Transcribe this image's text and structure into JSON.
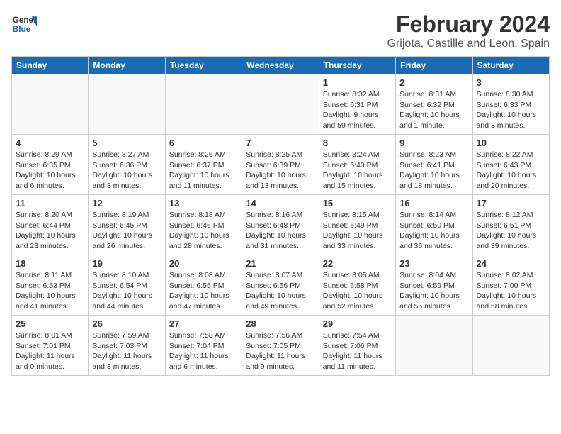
{
  "header": {
    "logo_line1": "General",
    "logo_line2": "Blue",
    "month_year": "February 2024",
    "location": "Grijota, Castille and Leon, Spain"
  },
  "weekdays": [
    "Sunday",
    "Monday",
    "Tuesday",
    "Wednesday",
    "Thursday",
    "Friday",
    "Saturday"
  ],
  "weeks": [
    [
      {
        "day": "",
        "info": ""
      },
      {
        "day": "",
        "info": ""
      },
      {
        "day": "",
        "info": ""
      },
      {
        "day": "",
        "info": ""
      },
      {
        "day": "1",
        "info": "Sunrise: 8:32 AM\nSunset: 6:31 PM\nDaylight: 9 hours and 59 minutes."
      },
      {
        "day": "2",
        "info": "Sunrise: 8:31 AM\nSunset: 6:32 PM\nDaylight: 10 hours and 1 minute."
      },
      {
        "day": "3",
        "info": "Sunrise: 8:30 AM\nSunset: 6:33 PM\nDaylight: 10 hours and 3 minutes."
      }
    ],
    [
      {
        "day": "4",
        "info": "Sunrise: 8:29 AM\nSunset: 6:35 PM\nDaylight: 10 hours and 6 minutes."
      },
      {
        "day": "5",
        "info": "Sunrise: 8:27 AM\nSunset: 6:36 PM\nDaylight: 10 hours and 8 minutes."
      },
      {
        "day": "6",
        "info": "Sunrise: 8:26 AM\nSunset: 6:37 PM\nDaylight: 10 hours and 11 minutes."
      },
      {
        "day": "7",
        "info": "Sunrise: 8:25 AM\nSunset: 6:39 PM\nDaylight: 10 hours and 13 minutes."
      },
      {
        "day": "8",
        "info": "Sunrise: 8:24 AM\nSunset: 6:40 PM\nDaylight: 10 hours and 15 minutes."
      },
      {
        "day": "9",
        "info": "Sunrise: 8:23 AM\nSunset: 6:41 PM\nDaylight: 10 hours and 18 minutes."
      },
      {
        "day": "10",
        "info": "Sunrise: 8:22 AM\nSunset: 6:43 PM\nDaylight: 10 hours and 20 minutes."
      }
    ],
    [
      {
        "day": "11",
        "info": "Sunrise: 8:20 AM\nSunset: 6:44 PM\nDaylight: 10 hours and 23 minutes."
      },
      {
        "day": "12",
        "info": "Sunrise: 8:19 AM\nSunset: 6:45 PM\nDaylight: 10 hours and 26 minutes."
      },
      {
        "day": "13",
        "info": "Sunrise: 8:18 AM\nSunset: 6:46 PM\nDaylight: 10 hours and 28 minutes."
      },
      {
        "day": "14",
        "info": "Sunrise: 8:16 AM\nSunset: 6:48 PM\nDaylight: 10 hours and 31 minutes."
      },
      {
        "day": "15",
        "info": "Sunrise: 8:15 AM\nSunset: 6:49 PM\nDaylight: 10 hours and 33 minutes."
      },
      {
        "day": "16",
        "info": "Sunrise: 8:14 AM\nSunset: 6:50 PM\nDaylight: 10 hours and 36 minutes."
      },
      {
        "day": "17",
        "info": "Sunrise: 8:12 AM\nSunset: 6:51 PM\nDaylight: 10 hours and 39 minutes."
      }
    ],
    [
      {
        "day": "18",
        "info": "Sunrise: 8:11 AM\nSunset: 6:53 PM\nDaylight: 10 hours and 41 minutes."
      },
      {
        "day": "19",
        "info": "Sunrise: 8:10 AM\nSunset: 6:54 PM\nDaylight: 10 hours and 44 minutes."
      },
      {
        "day": "20",
        "info": "Sunrise: 8:08 AM\nSunset: 6:55 PM\nDaylight: 10 hours and 47 minutes."
      },
      {
        "day": "21",
        "info": "Sunrise: 8:07 AM\nSunset: 6:56 PM\nDaylight: 10 hours and 49 minutes."
      },
      {
        "day": "22",
        "info": "Sunrise: 8:05 AM\nSunset: 6:58 PM\nDaylight: 10 hours and 52 minutes."
      },
      {
        "day": "23",
        "info": "Sunrise: 8:04 AM\nSunset: 6:59 PM\nDaylight: 10 hours and 55 minutes."
      },
      {
        "day": "24",
        "info": "Sunrise: 8:02 AM\nSunset: 7:00 PM\nDaylight: 10 hours and 58 minutes."
      }
    ],
    [
      {
        "day": "25",
        "info": "Sunrise: 8:01 AM\nSunset: 7:01 PM\nDaylight: 11 hours and 0 minutes."
      },
      {
        "day": "26",
        "info": "Sunrise: 7:59 AM\nSunset: 7:03 PM\nDaylight: 11 hours and 3 minutes."
      },
      {
        "day": "27",
        "info": "Sunrise: 7:58 AM\nSunset: 7:04 PM\nDaylight: 11 hours and 6 minutes."
      },
      {
        "day": "28",
        "info": "Sunrise: 7:56 AM\nSunset: 7:05 PM\nDaylight: 11 hours and 9 minutes."
      },
      {
        "day": "29",
        "info": "Sunrise: 7:54 AM\nSunset: 7:06 PM\nDaylight: 11 hours and 11 minutes."
      },
      {
        "day": "",
        "info": ""
      },
      {
        "day": "",
        "info": ""
      }
    ]
  ]
}
